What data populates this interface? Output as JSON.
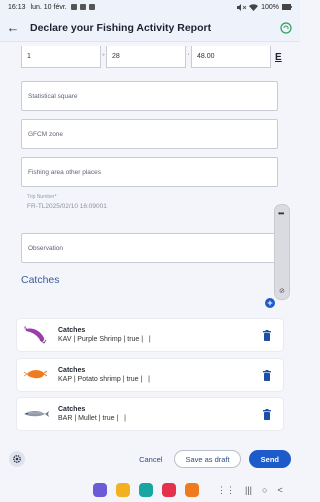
{
  "status_bar": {
    "time": "16:13",
    "date": "lun. 10 févr.",
    "battery": "100%"
  },
  "app_bar": {
    "title": "Declare your Fishing Activity Report"
  },
  "coordinates": {
    "degrees": "1",
    "minutes": "28",
    "seconds": "48.00",
    "hemisphere": "E"
  },
  "fields": {
    "statistical_square": "Statistical square",
    "gfcm_zone": "GFCM zone",
    "fishing_area_other": "Fishing area other places",
    "trip_number_label": "Trip Number*",
    "trip_number_value": "FR-TL2025/02/10 16:09001",
    "observation": "Observation"
  },
  "catches": {
    "title": "Catches",
    "items": [
      {
        "label": "Catches",
        "detail": "KAV | Purple Shrimp | true |   |",
        "icon": "purple-shrimp-icon"
      },
      {
        "label": "Catches",
        "detail": "KAP | Potato shrimp | true |   |",
        "icon": "potato-shrimp-icon"
      },
      {
        "label": "Catches",
        "detail": "BAR | Mullet | true |   |",
        "icon": "mullet-fish-icon"
      }
    ]
  },
  "actions": {
    "cancel": "Cancel",
    "save_draft": "Save as draft",
    "send": "Send"
  },
  "colors": {
    "accent": "#1c5bc9",
    "section_title": "#3c5c9b"
  }
}
